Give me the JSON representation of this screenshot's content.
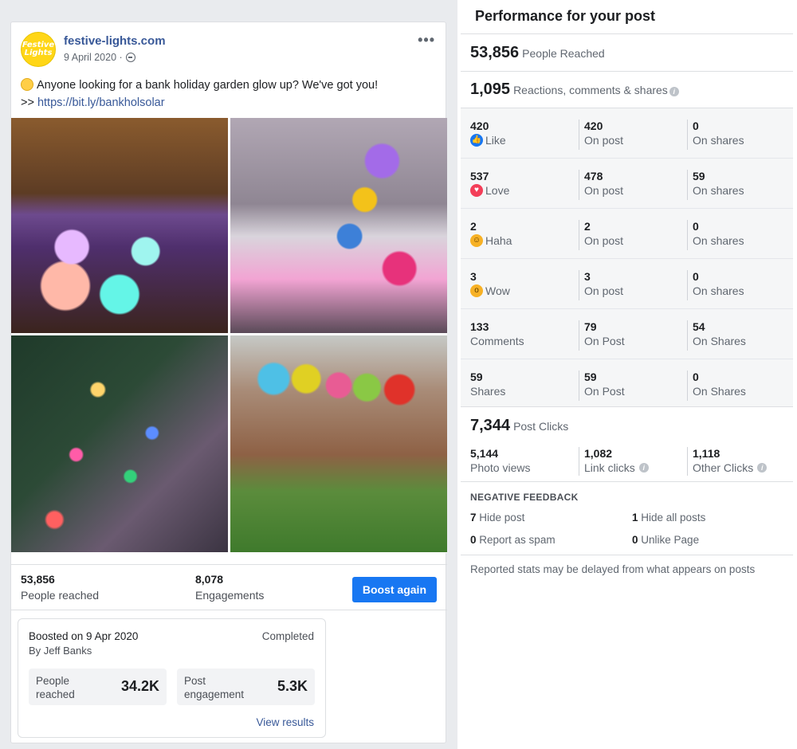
{
  "post": {
    "page_name": "festive-lights.com",
    "avatar_line1": "Festive",
    "avatar_line2": "Lights",
    "date": "9 April 2020 ·",
    "more_label": "•••",
    "text": "Anyone looking for a bank holiday garden glow up? We've got you!",
    "link_prefix": ">> ",
    "link": "https://bit.ly/bankholsolar",
    "people_reached": "53,856",
    "people_reached_label": "People reached",
    "engagements": "8,078",
    "engagements_label": "Engagements",
    "boost_again_label": "Boost again",
    "boost": {
      "title": "Boosted on 9 Apr 2020",
      "by": "By Jeff Banks",
      "status": "Completed",
      "people_reached_label": "People reached",
      "people_reached_value": "34.2K",
      "post_engagement_label": "Post engagement",
      "post_engagement_value": "5.3K",
      "view_results_label": "View results"
    }
  },
  "performance": {
    "title": "Performance for your post",
    "reached_value": "53,856",
    "reached_label": "People Reached",
    "reactions_value": "1,095",
    "reactions_label": "Reactions, comments & shares",
    "rows": [
      {
        "total": "420",
        "label": "Like",
        "on_post": "420",
        "on_post_label": "On post",
        "on_shares": "0",
        "on_shares_label": "On shares"
      },
      {
        "total": "537",
        "label": "Love",
        "on_post": "478",
        "on_post_label": "On post",
        "on_shares": "59",
        "on_shares_label": "On shares"
      },
      {
        "total": "2",
        "label": "Haha",
        "on_post": "2",
        "on_post_label": "On post",
        "on_shares": "0",
        "on_shares_label": "On shares"
      },
      {
        "total": "3",
        "label": "Wow",
        "on_post": "3",
        "on_post_label": "On post",
        "on_shares": "0",
        "on_shares_label": "On shares"
      },
      {
        "total": "133",
        "label": "Comments",
        "on_post": "79",
        "on_post_label": "On Post",
        "on_shares": "54",
        "on_shares_label": "On Shares"
      },
      {
        "total": "59",
        "label": "Shares",
        "on_post": "59",
        "on_post_label": "On Post",
        "on_shares": "0",
        "on_shares_label": "On Shares"
      }
    ],
    "post_clicks_value": "7,344",
    "post_clicks_label": "Post Clicks",
    "photo_views": "5,144",
    "photo_views_label": "Photo views",
    "link_clicks": "1,082",
    "link_clicks_label": "Link clicks",
    "other_clicks": "1,118",
    "other_clicks_label": "Other Clicks",
    "negative_title": "NEGATIVE FEEDBACK",
    "hide_post_value": "7",
    "hide_post_label": "Hide post",
    "hide_all_value": "1",
    "hide_all_label": "Hide all posts",
    "spam_value": "0",
    "spam_label": "Report as spam",
    "unlike_value": "0",
    "unlike_label": "Unlike Page",
    "footnote": "Reported stats may be delayed from what appears on posts"
  },
  "icons": {
    "like": "thumbs-up-icon",
    "love": "heart-icon",
    "haha": "laughing-face-icon",
    "wow": "surprised-face-icon",
    "info": "info-icon",
    "globe": "globe-icon"
  },
  "colors": {
    "accent": "#1877f2",
    "link": "#385898",
    "avatar": "#ffd617"
  }
}
